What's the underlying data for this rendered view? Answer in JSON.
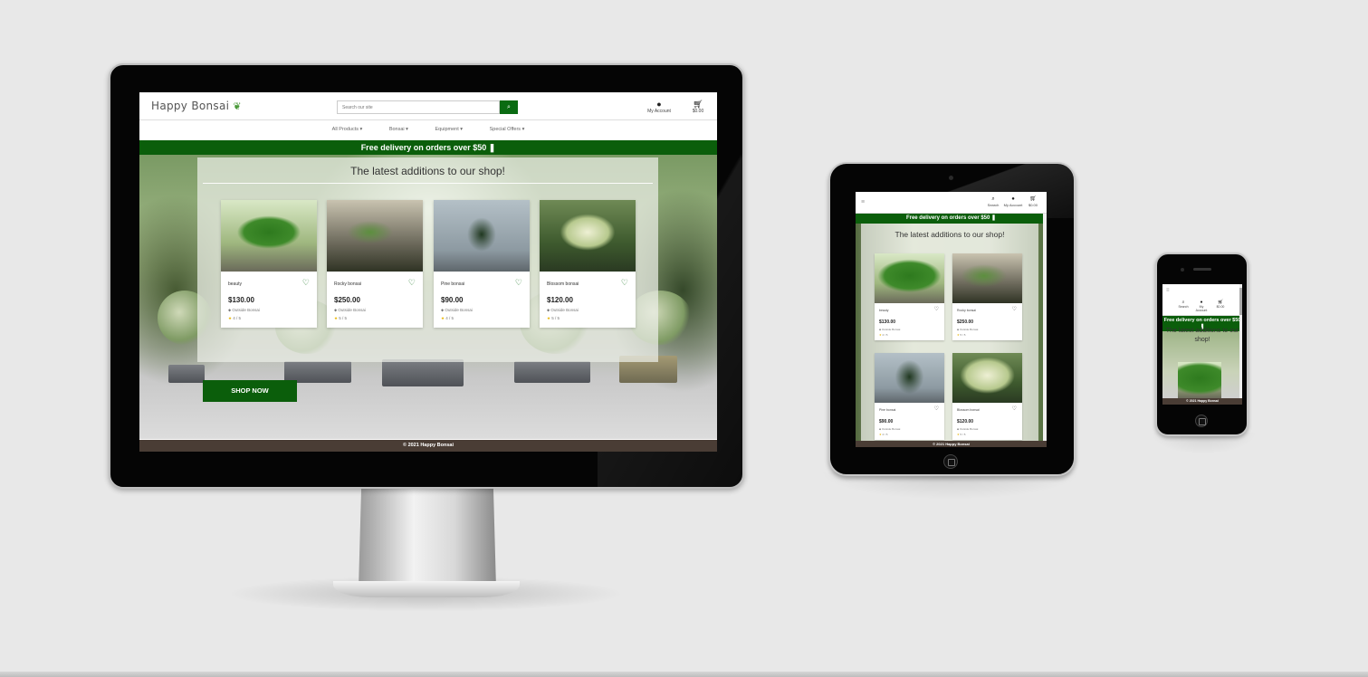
{
  "brand": {
    "name": "Happy Bonsai",
    "leaf": "❦"
  },
  "search": {
    "placeholder": "Search our site",
    "button_icon": "search-icon"
  },
  "account": {
    "label": "My Account",
    "icon": "user-icon"
  },
  "cart": {
    "total": "$0.00",
    "icon": "cart-icon"
  },
  "search_mobile": {
    "label": "Search"
  },
  "nav": [
    {
      "label": "All Products ▾"
    },
    {
      "label": "Bonsai ▾"
    },
    {
      "label": "Equipment ▾"
    },
    {
      "label": "Special Offers ▾"
    }
  ],
  "banner": {
    "text": "Free delivery on orders over $50 ❚"
  },
  "hero": {
    "title": "The latest additions to our shop!",
    "cta": "SHOP NOW"
  },
  "products": [
    {
      "name": "beauty",
      "price": "$130.00",
      "category": "Outside Bonsai",
      "rating": "4 / 5"
    },
    {
      "name": "Rocky bonsai",
      "price": "$250.00",
      "category": "Outside Bonsai",
      "rating": "5 / 5"
    },
    {
      "name": "Pine bonsai",
      "price": "$90.00",
      "category": "Outside Bonsai",
      "rating": "4 / 5"
    },
    {
      "name": "Blossom bonsai",
      "price": "$120.00",
      "category": "Outside Bonsai",
      "rating": "5 / 5"
    }
  ],
  "tablet_products": [
    {
      "name": "beauty",
      "price": "$130.00",
      "category": "Outside Bonsai",
      "rating": "4 / 5"
    },
    {
      "name": "Rocky bonsai",
      "price": "$250.00",
      "category": "Outside Bonsai",
      "rating": "5 / 5"
    },
    {
      "name": "Pine bonsai",
      "price": "$90.00",
      "category": "Outside Bonsai",
      "rating": "4 / 5"
    },
    {
      "name": "Blossom bonsai",
      "price": "$120.00",
      "category": "Outside Bonsai",
      "rating": "5 / 5"
    }
  ],
  "footer": {
    "text": "© 2021 Happy Bonsai"
  },
  "colors": {
    "brand_green": "#0b5e0b",
    "footer_brown": "#4a3d35",
    "star": "#e8b400"
  }
}
